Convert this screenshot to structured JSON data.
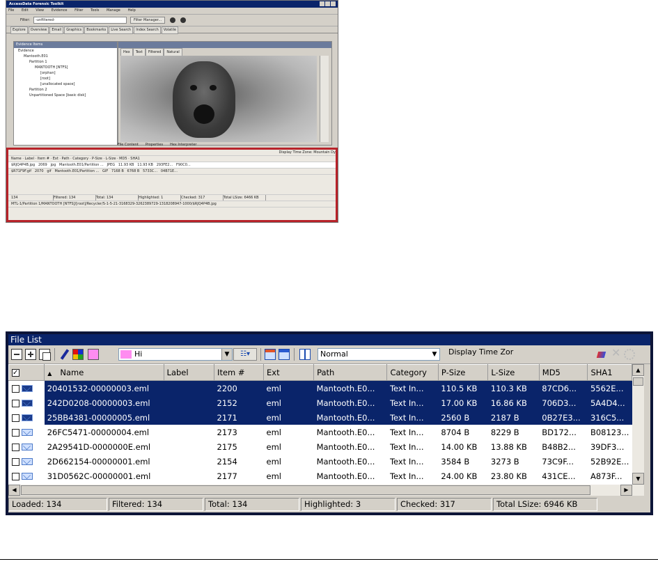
{
  "thumbnail": {
    "title": "AccessData Forensic Toolkit",
    "menu": [
      "File",
      "Edit",
      "View",
      "Evidence",
      "Filter",
      "Tools",
      "Manage",
      "Help"
    ],
    "filter_label": "Filter:",
    "filter_value": "-unfiltered-",
    "filter_manager": "Filter Manager...",
    "tabs": [
      "Explore",
      "Overview",
      "Email",
      "Graphics",
      "Bookmarks",
      "Live Search",
      "Index Search",
      "Volatile"
    ],
    "evidence_tree_title": "Evidence Items",
    "tree": [
      "Evidence",
      "Mantooth.E01",
      "Partition 1",
      "MANTOOTH [NTFS]",
      "[orphan]",
      "[root]",
      "[unallocated space]",
      "Partition 2",
      "Unpartitioned Space [basic disk]"
    ],
    "viewer_tabs": [
      "Hex",
      "Text",
      "Filtered",
      "Natural"
    ],
    "bottom_tabs": [
      "File Content",
      "Properties",
      "Hex Interpreter"
    ],
    "rows": [
      [
        "$RJQ4P4B.jpg",
        "2069",
        "jpg",
        "Mantooth.E01/Partition ...",
        "JPEG",
        "11.93 KB",
        "11.93 KB",
        "293FE2...",
        "F90C0..."
      ],
      [
        "$R71F9F.gif",
        "2070",
        "gif",
        "Mantooth.E01/Partition ...",
        "GIF",
        "7168 B",
        "6768 B",
        "5733C...",
        "04B71E..."
      ]
    ],
    "status": [
      "134",
      "Filtered: 134",
      "Total: 134",
      "Highlighted: 1",
      "Checked: 317",
      "Total LSize: 6466 KB"
    ],
    "path": "MTL-1/Partition 1/MANTOOTH [NTFS]/[root]/Recycler/S-1-5-21-3168329-3262389729-1318208947-1000/$RJQ4P4B.jpg",
    "display_tz": "Display Time Zone: Mountain Dy"
  },
  "file_list": {
    "title": "File List",
    "color_combo": "Hi",
    "view_combo": "Normal",
    "display_tz": "Display Time Zor",
    "columns": [
      "",
      "Name",
      "Label",
      "Item #",
      "Ext",
      "Path",
      "Category",
      "P-Size",
      "L-Size",
      "MD5",
      "SHA1"
    ],
    "rows": [
      {
        "selected": true,
        "name": "20401532-00000003.eml",
        "label": "",
        "item": "2200",
        "ext": "eml",
        "path": "Mantooth.E0...",
        "category": "Text In...",
        "psize": "110.5 KB",
        "lsize": "110.3 KB",
        "md5": "87CD6...",
        "sha1": "5562E..."
      },
      {
        "selected": true,
        "name": "242D0208-00000003.eml",
        "label": "",
        "item": "2152",
        "ext": "eml",
        "path": "Mantooth.E0...",
        "category": "Text In...",
        "psize": "17.00 KB",
        "lsize": "16.86 KB",
        "md5": "706D3...",
        "sha1": "5A4D4..."
      },
      {
        "selected": true,
        "name": "25BB4381-00000005.eml",
        "label": "",
        "item": "2171",
        "ext": "eml",
        "path": "Mantooth.E0...",
        "category": "Text In...",
        "psize": "2560 B",
        "lsize": "2187 B",
        "md5": "0B27E3...",
        "sha1": "316C5..."
      },
      {
        "selected": false,
        "name": "26FC5471-00000004.eml",
        "label": "",
        "item": "2173",
        "ext": "eml",
        "path": "Mantooth.E0...",
        "category": "Text In...",
        "psize": "8704 B",
        "lsize": "8229 B",
        "md5": "BD172...",
        "sha1": "B08123..."
      },
      {
        "selected": false,
        "name": "2A29541D-0000000E.eml",
        "label": "",
        "item": "2175",
        "ext": "eml",
        "path": "Mantooth.E0...",
        "category": "Text In...",
        "psize": "14.00 KB",
        "lsize": "13.88 KB",
        "md5": "B48B2...",
        "sha1": "39DF3..."
      },
      {
        "selected": false,
        "name": "2D662154-00000001.eml",
        "label": "",
        "item": "2154",
        "ext": "eml",
        "path": "Mantooth.E0...",
        "category": "Text In...",
        "psize": "3584 B",
        "lsize": "3273 B",
        "md5": "73C9F...",
        "sha1": "52B92E..."
      },
      {
        "selected": false,
        "name": "31D0562C-00000001.eml",
        "label": "",
        "item": "2177",
        "ext": "eml",
        "path": "Mantooth.E0...",
        "category": "Text In...",
        "psize": "24.00 KB",
        "lsize": "23.80 KB",
        "md5": "431CE...",
        "sha1": "A873F..."
      }
    ],
    "status": {
      "loaded": "Loaded: 134",
      "filtered": "Filtered: 134",
      "total": "Total: 134",
      "highlighted": "Highlighted: 3",
      "checked": "Checked: 317",
      "total_lsize": "Total LSize: 6946 KB"
    }
  },
  "colors": {
    "selection": "#0a246a",
    "frame": "#0d1538",
    "highlight_box": "#b8232a",
    "swatch": "#ff8cf0"
  }
}
